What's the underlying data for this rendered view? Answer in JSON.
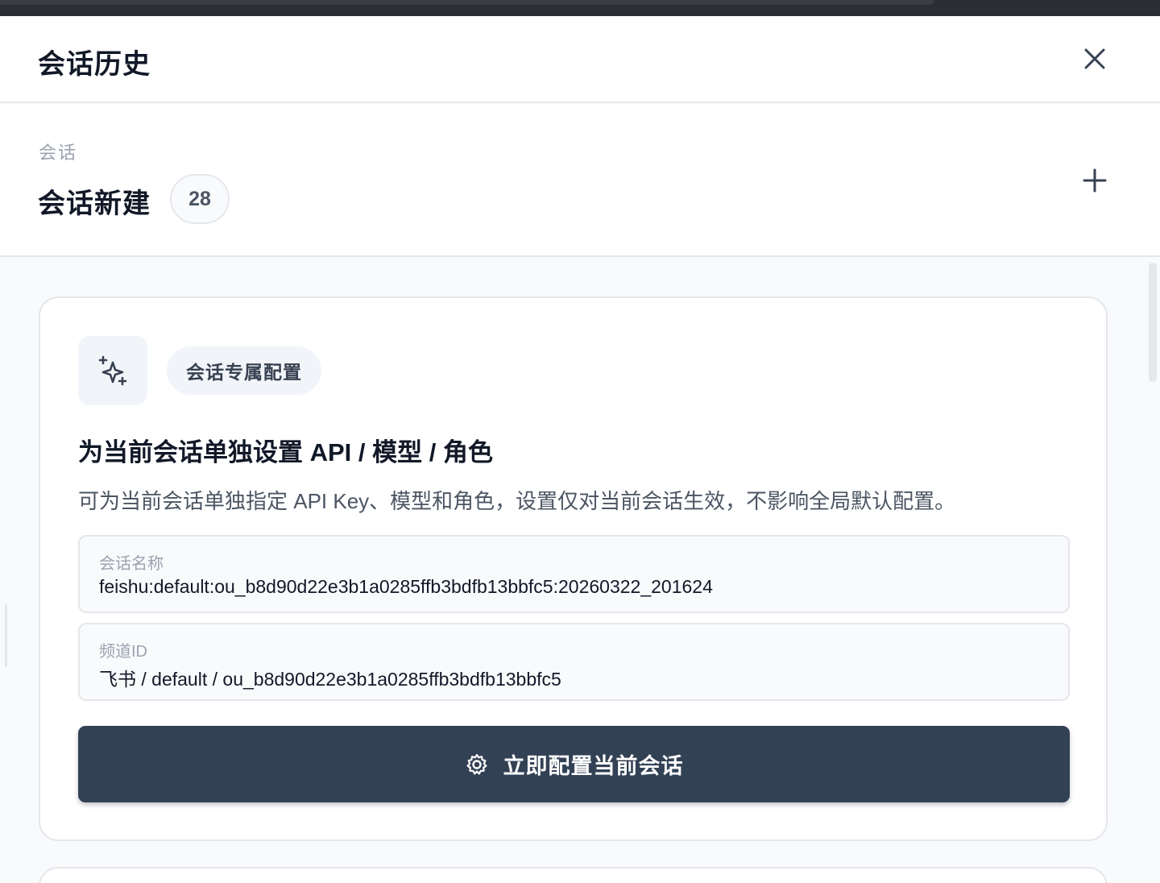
{
  "header": {
    "title": "会话历史",
    "close_icon": "close-icon"
  },
  "session": {
    "section_label": "会话",
    "name": "会话新建",
    "count": "28",
    "add_icon": "plus-icon"
  },
  "config_card": {
    "icon": "sparkles-icon",
    "pill_label": "会话专属配置",
    "title": "为当前会话单独设置 API / 模型 / 角色",
    "description": "可为当前会话单独指定 API Key、模型和角色，设置仅对当前会话生效，不影响全局默认配置。",
    "fields": [
      {
        "label": "会话名称",
        "value": "feishu:default:ou_b8d90d22e3b1a0285ffb3bdfb13bbfc5:20260322_201624"
      },
      {
        "label": "频道ID",
        "value": "飞书 / default / ou_b8d90d22e3b1a0285ffb3bdfb13bbfc5"
      }
    ],
    "button": {
      "icon": "gear-icon",
      "label": "立即配置当前会话"
    }
  },
  "colors": {
    "primary_button": "#334155",
    "page_background": "#f8fafc",
    "border": "#e5e7eb"
  }
}
